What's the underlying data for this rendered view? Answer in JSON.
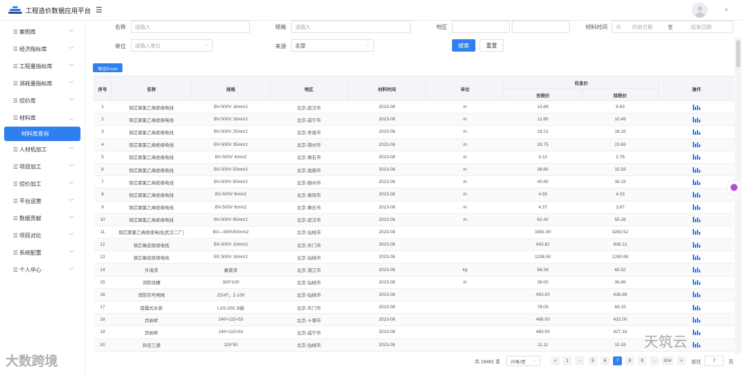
{
  "app": {
    "title": "工程造价数据应用平台",
    "menu_icon": "hamburger-icon",
    "avatar_icon": "user-avatar-icon",
    "avatar_caret": "˅"
  },
  "sidebar": {
    "items": [
      {
        "label": "案例库",
        "chevron": "down"
      },
      {
        "label": "经济指标库",
        "chevron": "down"
      },
      {
        "label": "工程量指标库",
        "chevron": "down"
      },
      {
        "label": "消耗量指标库",
        "chevron": "down"
      },
      {
        "label": "综价库",
        "chevron": "down"
      },
      {
        "label": "材料库",
        "chevron": "up"
      },
      {
        "label": "人材机加工",
        "chevron": "down"
      },
      {
        "label": "项目加工",
        "chevron": "down"
      },
      {
        "label": "综价加工",
        "chevron": "down"
      },
      {
        "label": "平台运营",
        "chevron": "down"
      },
      {
        "label": "数据贡献",
        "chevron": "down"
      },
      {
        "label": "项目对比",
        "chevron": "down"
      },
      {
        "label": "系统配置",
        "chevron": "down"
      },
      {
        "label": "个人中心",
        "chevron": "down"
      }
    ],
    "active_sub": "材料库查询"
  },
  "filters": {
    "name_label": "名称",
    "name_placeholder": "请输入",
    "spec_label": "规格",
    "spec_placeholder": "请输入",
    "region_label": "地区",
    "time_label": "材料时间",
    "start_placeholder": "开始日期",
    "range_sep": "至",
    "end_placeholder": "结束日期",
    "unit_label": "单位",
    "unit_placeholder": "请输入单位",
    "source_label": "来源",
    "source_value": "全部",
    "search_button": "搜索",
    "reset_button": "重置"
  },
  "export_button": "导出Excel",
  "table": {
    "headers": {
      "index": "序号",
      "name": "名称",
      "spec": "规格",
      "region": "地区",
      "time": "材料时间",
      "unit": "单位",
      "info_price": "信息价",
      "tax_incl": "含税价",
      "tax_excl": "除税价",
      "action": "操作"
    },
    "rows": [
      [
        "1",
        "铜芯聚氯乙烯绝缘电线",
        "BV-500V 16mm2",
        "北京-武汉市",
        "2023-08",
        "m",
        "10.88",
        "9.63"
      ],
      [
        "2",
        "铜芯聚氯乙烯绝缘电线",
        "BV-500V 16mm2",
        "北京-咸宁市",
        "2023-08",
        "m",
        "11.85",
        "10.49"
      ],
      [
        "3",
        "铜芯聚氯乙烯绝缘电线",
        "BV-500V 25mm2",
        "北京-孝感市",
        "2023-08",
        "m",
        "18.21",
        "16.15"
      ],
      [
        "4",
        "铜芯聚氯乙烯绝缘电线",
        "BV-500V 35mm2",
        "北京-鄂州市",
        "2023-08",
        "m",
        "26.75",
        "23.69"
      ],
      [
        "5",
        "铜芯聚氯乙烯绝缘电线",
        "BV-500V 4mm2",
        "北京-黄石市",
        "2023-08",
        "m",
        "3.12",
        "2.76"
      ],
      [
        "6",
        "铜芯聚氯乙烯绝缘电线",
        "BV-500V 50mm2",
        "北京-恩施市",
        "2023-08",
        "m",
        "36.80",
        "32.59"
      ],
      [
        "7",
        "铜芯聚氯乙烯绝缘电线",
        "BV-500V 50mm2",
        "北京-随州市",
        "2023-08",
        "m",
        "40.90",
        "36.19"
      ],
      [
        "8",
        "铜芯聚氯乙烯绝缘电线",
        "BV-500V 6mm2",
        "北京-黄冈市",
        "2023-08",
        "m",
        "4.55",
        "4.03"
      ],
      [
        "9",
        "铜芯聚氯乙烯绝缘电线",
        "BV-500V 6mm2",
        "北京-黄石市",
        "2023-08",
        "m",
        "4.37",
        "3.87"
      ],
      [
        "10",
        "铜芯聚氯乙烯绝缘电线",
        "BV-500V 95mm2",
        "北京-武汉市",
        "2023-08",
        "m",
        "62.42",
        "55.28"
      ],
      [
        "11",
        "铜芯聚氯乙烯绝缘电线(武汉二厂)",
        "BV—500V50mm2",
        "北京-仙桃市",
        "2023-08",
        "",
        "3381.00",
        "3282.52"
      ],
      [
        "12",
        "铜芯橡皮绝缘电线",
        "BX-500V 10mm2",
        "北京-天门市",
        "2023-08",
        "",
        "943.82",
        "836.12"
      ],
      [
        "13",
        "铜芯橡皮绝缘电线",
        "BX 500V 16mm2",
        "北京-仙桃市",
        "2023-08",
        "",
        "1298.50",
        "1260.68"
      ],
      [
        "14",
        "外墙漆",
        "氟碳漆",
        "北京-潜江市",
        "2023-08",
        "kg",
        "68.39",
        "60.52"
      ],
      [
        "15",
        "消防线槽",
        "300*100",
        "北京-仙桃市",
        "2023-08",
        "m",
        "38.00",
        "36.89"
      ],
      [
        "16",
        "消防信号闸阀",
        "ZSXF。Z-100",
        "北京-仙桃市",
        "2023-08",
        "",
        "450.00",
        "436.89"
      ],
      [
        "17",
        "旋翼式水表",
        "LXS-20C B级",
        "北京-天门市",
        "2023-08",
        "",
        "78.05",
        "69.15"
      ],
      [
        "18",
        "页岩砖",
        "240×115×53",
        "北京-十堰市",
        "2023-08",
        "",
        "486.00",
        "432.00"
      ],
      [
        "19",
        "页岩砖",
        "240×115×53",
        "北京-咸宁市",
        "2023-08",
        "",
        "480.00",
        "427.18"
      ],
      [
        "20",
        "异径三通",
        "125*50",
        "北京-仙桃市",
        "2023-08",
        "",
        "11.11",
        "10.19"
      ]
    ]
  },
  "pagination": {
    "total": "共 18461 条",
    "page_size": "20条/页",
    "prev": "<",
    "next": ">",
    "pages": [
      "1",
      "···",
      "5",
      "6",
      "7",
      "8",
      "9",
      "···",
      "924"
    ],
    "active_page": "7",
    "goto_label": "前往",
    "goto_value": "7",
    "page_suffix": "页"
  },
  "watermarks": {
    "left": "大数跨境",
    "right": "天筑云"
  }
}
